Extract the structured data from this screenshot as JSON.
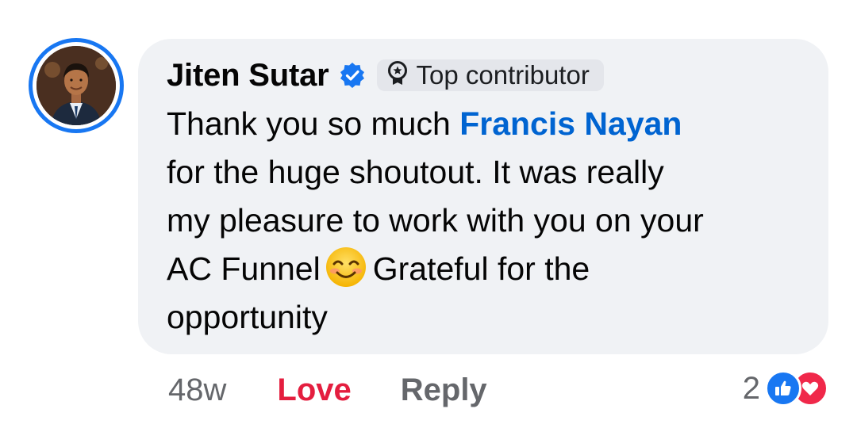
{
  "comment": {
    "author": "Jiten Sutar",
    "badge_label": "Top contributor",
    "lines": [
      {
        "before": "Thank you so much ",
        "mention": "Francis Nayan"
      },
      {
        "text": "for the huge shoutout. It was really"
      },
      {
        "text": "my pleasure to work with you on your"
      },
      {
        "before": "AC Funnel",
        "emoji": "smiling-face-emoji",
        "after": "Grateful for the"
      },
      {
        "text": "opportunity"
      }
    ]
  },
  "actions": {
    "time": "48w",
    "love_label": "Love",
    "reply_label": "Reply"
  },
  "reactions": {
    "count": "2",
    "types": [
      "like-icon",
      "heart-icon"
    ]
  },
  "colors": {
    "accent": "#1877f2",
    "mention": "#0064d1",
    "love": "#e41e3f",
    "bubble": "#f0f2f5",
    "secondary_text": "#65676b"
  }
}
